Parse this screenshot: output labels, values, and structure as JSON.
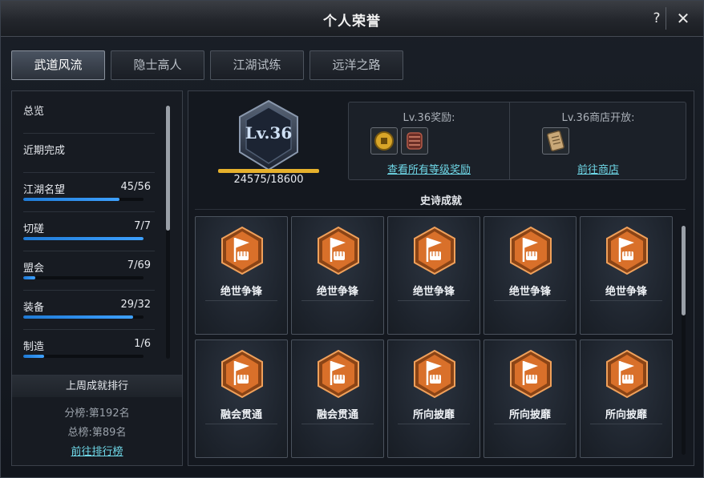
{
  "window": {
    "title": "个人荣誉",
    "help_label": "?",
    "close_label": "✕"
  },
  "tabs": [
    {
      "label": "武道风流",
      "active": true
    },
    {
      "label": "隐士高人",
      "active": false
    },
    {
      "label": "江湖试练",
      "active": false
    },
    {
      "label": "远洋之路",
      "active": false
    }
  ],
  "sidebar": {
    "items": [
      {
        "label": "总览"
      },
      {
        "label": "近期完成"
      },
      {
        "label": "江湖名望",
        "value": "45/56",
        "progress": 0.8
      },
      {
        "label": "切磋",
        "value": "7/7",
        "progress": 1.0
      },
      {
        "label": "盟会",
        "value": "7/69",
        "progress": 0.1
      },
      {
        "label": "装备",
        "value": "29/32",
        "progress": 0.91
      },
      {
        "label": "制造",
        "value": "1/6",
        "progress": 0.17
      }
    ]
  },
  "ranking": {
    "title": "上周成就排行",
    "sub_rank": "分榜:第192名",
    "total_rank": "总榜:第89名",
    "link": "前往排行榜"
  },
  "level": {
    "label": "Lv.36",
    "exp": "24575/18600",
    "exp_progress": 1.0
  },
  "rewards": {
    "title": "Lv.36奖励:",
    "link": "查看所有等级奖励",
    "icons": [
      "gold-coin-icon",
      "armor-bracer-icon"
    ]
  },
  "shop": {
    "title": "Lv.36商店开放:",
    "link": "前往商店",
    "icons": [
      "scroll-book-icon"
    ]
  },
  "epic": {
    "title": "史诗成就",
    "items": [
      {
        "name": "绝世争锋"
      },
      {
        "name": "绝世争锋"
      },
      {
        "name": "绝世争锋"
      },
      {
        "name": "绝世争锋"
      },
      {
        "name": "绝世争锋"
      },
      {
        "name": "融会贯通"
      },
      {
        "name": "融会贯通"
      },
      {
        "name": "所向披靡"
      },
      {
        "name": "所向披靡"
      },
      {
        "name": "所向披靡"
      }
    ]
  },
  "colors": {
    "accent_link": "#6fd8e8",
    "progress_blue": "#2f8fe8",
    "exp_gold": "#e6b12c",
    "badge_orange": "#d9702a"
  }
}
